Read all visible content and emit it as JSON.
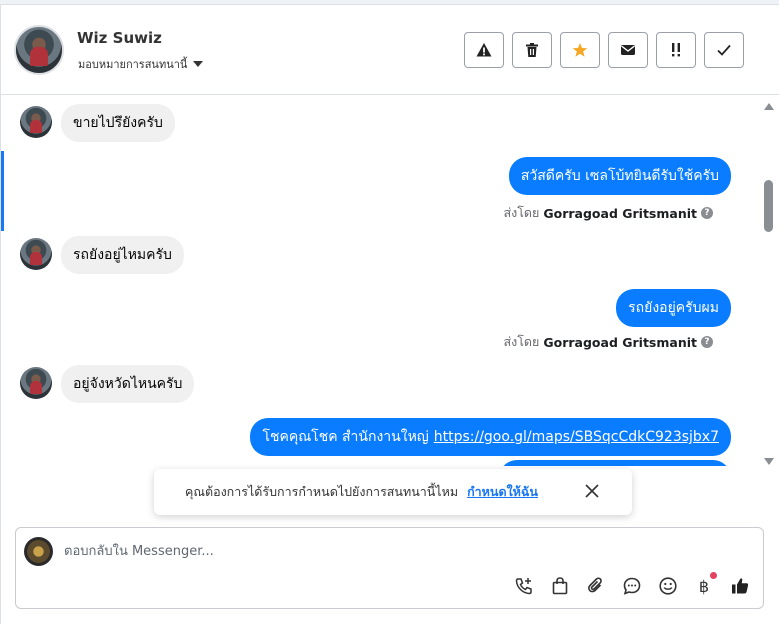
{
  "header": {
    "contact_name": "Wiz Suwiz",
    "assign_label": "มอบหมายการสนทนานี้",
    "toolbar": [
      {
        "name": "spam-button",
        "icon": "warning-icon"
      },
      {
        "name": "delete-button",
        "icon": "trash-icon"
      },
      {
        "name": "star-button",
        "icon": "star-icon"
      },
      {
        "name": "mark-unread-button",
        "icon": "envelope-icon"
      },
      {
        "name": "follow-up-button",
        "icon": "exclamation-icon"
      },
      {
        "name": "mark-done-button",
        "icon": "checkmark-icon"
      }
    ]
  },
  "messages": [
    {
      "direction": "in",
      "text": "ขายไปรึยังครับ"
    },
    {
      "direction": "out",
      "text": "สวัสดีครับ เซลโบ้ทยินดีรับใช้ครับ",
      "sent_by_label": "ส่งโดย",
      "sender": "Gorragoad Gritsmanit"
    },
    {
      "direction": "in",
      "text": "รถยังอยู่ไหมครับ"
    },
    {
      "direction": "out",
      "text": "รถยังอยู่ครับผม",
      "sent_by_label": "ส่งโดย",
      "sender": "Gorragoad Gritsmanit"
    },
    {
      "direction": "in",
      "text": "อยู่จังหวัดไหนครับ"
    },
    {
      "direction": "out",
      "text": "โชคคุณโชค สำนักงานใหญ่",
      "link": "https://goo.gl/maps/SBSqcCdkC923sjbx7"
    }
  ],
  "notice": {
    "text": "คุณต้องการได้รับการกำหนดไปยังการสนทนานี้ไหม",
    "action": "กำหนดให้ฉัน"
  },
  "composer": {
    "placeholder": "ตอบกลับใน Messenger...",
    "currency_symbol": "฿"
  },
  "colors": {
    "accent": "#0a7cff",
    "star": "#f5a623",
    "badge": "#e4405f"
  }
}
